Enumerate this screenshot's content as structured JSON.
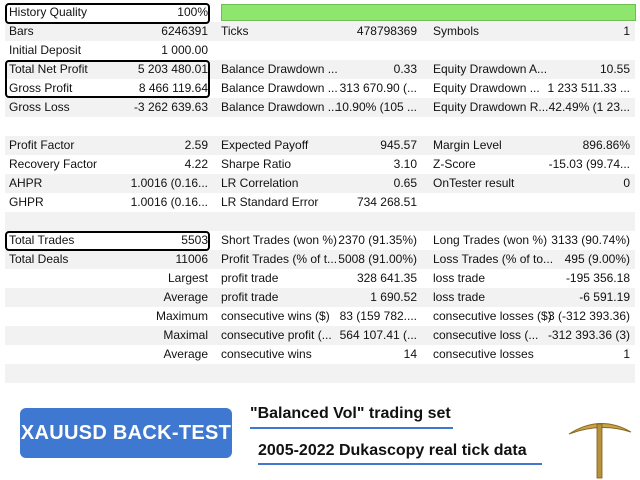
{
  "rows": [
    {
      "c1l": "History Quality",
      "c1v": "100%",
      "bar": true
    },
    {
      "c1l": "Bars",
      "c1v": "6246391",
      "c2l": "Ticks",
      "c2v": "478798369",
      "c3l": "Symbols",
      "c3v": "1"
    },
    {
      "c1l": "Initial Deposit",
      "c1v": "1 000.00"
    },
    {
      "c1l": "Total Net Profit",
      "c1v": "5 203 480.01",
      "c2l": "Balance Drawdown ...",
      "c2v": "0.33",
      "c3l": "Equity Drawdown A...",
      "c3v": "10.55"
    },
    {
      "c1l": "Gross Profit",
      "c1v": "8 466 119.64",
      "c2l": "Balance Drawdown ...",
      "c2v": "313 670.90 (...",
      "c3l": "Equity Drawdown ...",
      "c3v": "1 233 511.33 ..."
    },
    {
      "c1l": "Gross Loss",
      "c1v": "-3 262 639.63",
      "c2l": "Balance Drawdown ...",
      "c2v": "10.90% (105 ...",
      "c3l": "Equity Drawdown R...",
      "c3v": "42.49% (1 23..."
    },
    {},
    {
      "c1l": "Profit Factor",
      "c1v": "2.59",
      "c2l": "Expected Payoff",
      "c2v": "945.57",
      "c3l": "Margin Level",
      "c3v": "896.86%"
    },
    {
      "c1l": "Recovery Factor",
      "c1v": "4.22",
      "c2l": "Sharpe Ratio",
      "c2v": "3.10",
      "c3l": "Z-Score",
      "c3v": "-15.03 (99.74..."
    },
    {
      "c1l": "AHPR",
      "c1v": "1.0016 (0.16...",
      "c2l": "LR Correlation",
      "c2v": "0.65",
      "c3l": "OnTester result",
      "c3v": "0"
    },
    {
      "c1l": "GHPR",
      "c1v": "1.0016 (0.16...",
      "c2l": "LR Standard Error",
      "c2v": "734 268.51"
    },
    {},
    {
      "c1l": "Total Trades",
      "c1v": "5503",
      "c2l": "Short Trades (won %)",
      "c2v": "2370 (91.35%)",
      "c3l": "Long Trades (won %)",
      "c3v": "3133 (90.74%)"
    },
    {
      "c1l": "Total Deals",
      "c1v": "11006",
      "c2l": "Profit Trades (% of t...",
      "c2v": "5008 (91.00%)",
      "c3l": "Loss Trades (% of to...",
      "c3v": "495 (9.00%)"
    },
    {
      "c1v": "Largest",
      "c2l": "profit trade",
      "c2v": "328 641.35",
      "c3l": "loss trade",
      "c3v": "-195 356.18"
    },
    {
      "c1v": "Average",
      "c2l": "profit trade",
      "c2v": "1 690.52",
      "c3l": "loss trade",
      "c3v": "-6 591.19"
    },
    {
      "c1v": "Maximum",
      "c2l": "consecutive wins ($)",
      "c2v": "83 (159 782....",
      "c3l": "consecutive losses ($)",
      "c3v": "3 (-312 393.36)"
    },
    {
      "c1v": "Maximal",
      "c2l": "consecutive profit (...",
      "c2v": "564 107.41 (...",
      "c3l": "consecutive loss (...",
      "c3v": "-312 393.36 (3)"
    },
    {
      "c1v": "Average",
      "c2l": "consecutive wins",
      "c2v": "14",
      "c3l": "consecutive losses",
      "c3v": "1"
    },
    {}
  ],
  "history_quality_fraction": 1.0,
  "banner": {
    "button_label": "XAUUSD BACK-TEST",
    "caption1": "\"Balanced Vol\" trading set",
    "caption2": "2005-2022 Dukascopy real tick data",
    "accent_color": "#3f78d0",
    "icon": "pickaxe-icon"
  }
}
